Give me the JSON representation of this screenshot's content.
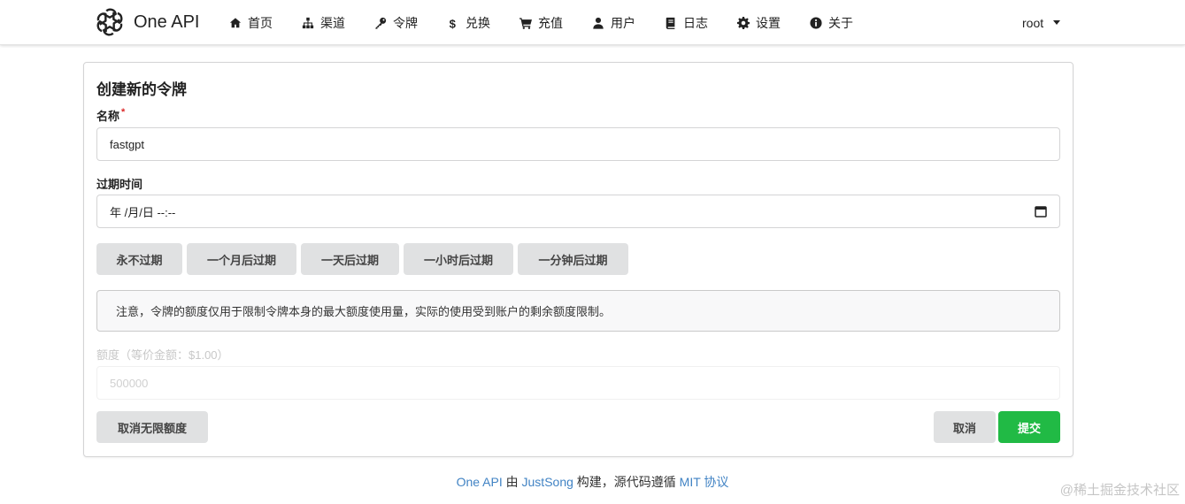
{
  "brand": {
    "name": "One API"
  },
  "nav": {
    "items": [
      {
        "label": "首页",
        "icon": "home-icon"
      },
      {
        "label": "渠道",
        "icon": "sitemap-icon"
      },
      {
        "label": "令牌",
        "icon": "key-icon"
      },
      {
        "label": "兑换",
        "icon": "dollar-icon"
      },
      {
        "label": "充值",
        "icon": "cart-icon"
      },
      {
        "label": "用户",
        "icon": "user-icon"
      },
      {
        "label": "日志",
        "icon": "book-icon"
      },
      {
        "label": "设置",
        "icon": "gear-icon"
      },
      {
        "label": "关于",
        "icon": "info-icon"
      }
    ],
    "user": "root"
  },
  "form": {
    "title": "创建新的令牌",
    "name_label": "名称",
    "name_required_mark": "*",
    "name_value": "fastgpt",
    "expire_label": "过期时间",
    "expire_value": "年 /月/日 --:--",
    "quick_buttons": [
      "永不过期",
      "一个月后过期",
      "一天后过期",
      "一小时后过期",
      "一分钟后过期"
    ],
    "notice": "注意，令牌的额度仅用于限制令牌本身的最大额度使用量，实际的使用受到账户的剩余额度限制。",
    "quota_label": "额度（等价金额：$1.00）",
    "quota_value": "500000",
    "unlimited_button": "取消无限额度",
    "cancel_button": "取消",
    "submit_button": "提交"
  },
  "footer": {
    "app_link": "One API",
    "by": "由",
    "author_link": "JustSong",
    "middle": "构建，源代码遵循",
    "license_link": "MIT 协议"
  },
  "watermark": "@稀土掘金技术社区",
  "colors": {
    "submit": "#21ba45",
    "link": "#4183c4",
    "button_gray": "#e0e1e2",
    "required": "#db2828"
  }
}
